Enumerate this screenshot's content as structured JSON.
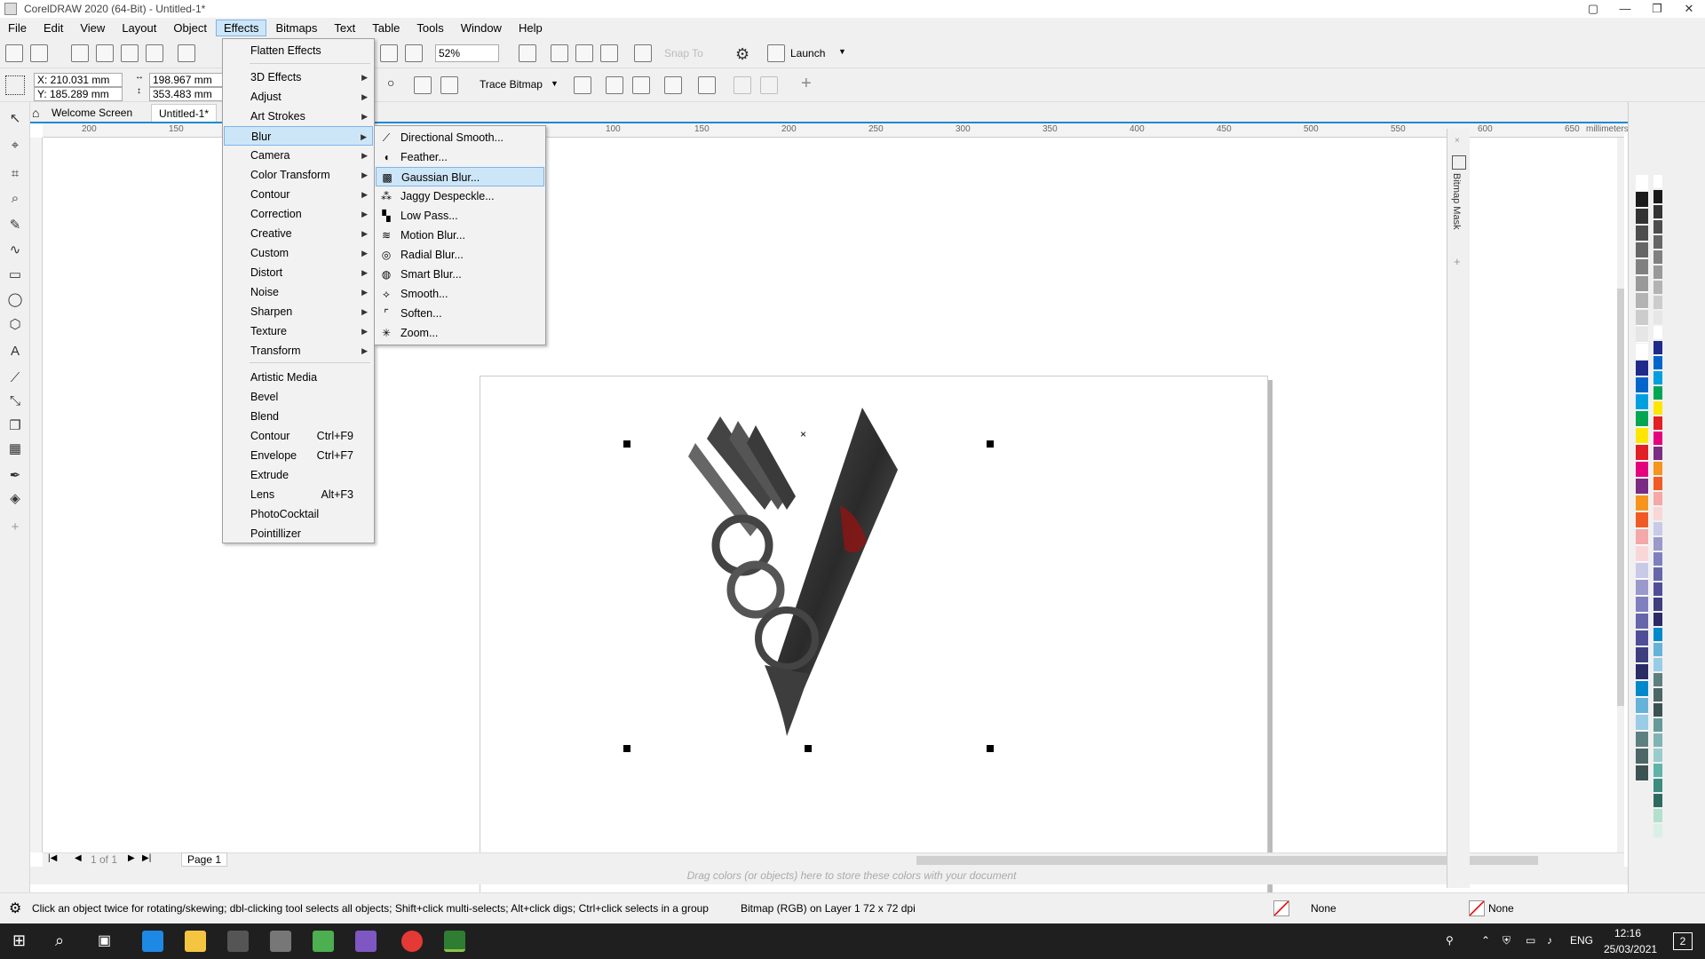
{
  "window": {
    "title": "CorelDRAW 2020 (64-Bit) - Untitled-1*"
  },
  "menubar": [
    "File",
    "Edit",
    "View",
    "Layout",
    "Object",
    "Effects",
    "Bitmaps",
    "Text",
    "Table",
    "Tools",
    "Window",
    "Help"
  ],
  "toolbar": {
    "zoom": "52%",
    "snap_to": "Snap To",
    "launch": "Launch",
    "trace_bitmap": "Trace Bitmap"
  },
  "properties": {
    "x": "X: 210.031 mm",
    "y": "Y: 185.289 mm",
    "w": "198.967 mm",
    "h": "353.483 mm"
  },
  "tabs": [
    "Welcome Screen",
    "Untitled-1*"
  ],
  "ruler": {
    "top": [
      "200",
      "150",
      "100",
      "150",
      "200",
      "250",
      "300",
      "350",
      "400",
      "450",
      "500",
      "550",
      "600",
      "650"
    ],
    "unit": "millimeters"
  },
  "effects_menu": {
    "top_item": "Flatten Effects",
    "submenus": [
      "3D Effects",
      "Adjust",
      "Art Strokes",
      "Blur",
      "Camera",
      "Color Transform",
      "Contour",
      "Correction",
      "Creative",
      "Custom",
      "Distort",
      "Noise",
      "Sharpen",
      "Texture",
      "Transform"
    ],
    "commands": [
      {
        "label": "Artistic Media",
        "shortcut": ""
      },
      {
        "label": "Bevel",
        "shortcut": ""
      },
      {
        "label": "Blend",
        "shortcut": ""
      },
      {
        "label": "Contour",
        "shortcut": "Ctrl+F9"
      },
      {
        "label": "Envelope",
        "shortcut": "Ctrl+F7"
      },
      {
        "label": "Extrude",
        "shortcut": ""
      },
      {
        "label": "Lens",
        "shortcut": "Alt+F3"
      },
      {
        "label": "PhotoCocktail",
        "shortcut": ""
      },
      {
        "label": "Pointillizer",
        "shortcut": ""
      }
    ],
    "highlighted": "Blur"
  },
  "blur_menu": {
    "items": [
      "Directional Smooth...",
      "Feather...",
      "Gaussian Blur...",
      "Jaggy Despeckle...",
      "Low Pass...",
      "Motion Blur...",
      "Radial Blur...",
      "Smart Blur...",
      "Smooth...",
      "Soften...",
      "Zoom..."
    ],
    "highlighted": "Gaussian Blur..."
  },
  "pagebar": {
    "counter": "1 of 1",
    "page": "Page 1"
  },
  "palette_hint": "Drag colors (or objects) here to store these colors with your document",
  "status": {
    "hint": "Click an object twice for rotating/skewing; dbl-clicking tool selects all objects; Shift+click multi-selects; Alt+click digs; Ctrl+click selects in a group",
    "object_info": "Bitmap (RGB) on Layer 1 72 x 72 dpi",
    "fill": "None",
    "outline": "None"
  },
  "docker": {
    "title": "Bitmap Mask"
  },
  "taskbar": {
    "lang": "ENG",
    "time": "12:16",
    "date": "25/03/2021",
    "notifications": "2"
  },
  "palette_colors": [
    "#ffffff",
    "#1a1a1a",
    "#333333",
    "#4d4d4d",
    "#666666",
    "#808080",
    "#999999",
    "#b3b3b3",
    "#cccccc",
    "#e6e6e6",
    "#ffffff",
    "#1f2a8c",
    "#0066cc",
    "#00a0e0",
    "#00a651",
    "#ffe600",
    "#e31e24",
    "#e5007e",
    "#7b2c83",
    "#f7941d",
    "#f15a24",
    "#f4a8a8",
    "#f9d7d7",
    "#c9c9e8",
    "#9999cc",
    "#7f7fbf",
    "#6666aa",
    "#4f4f99",
    "#3d3d80",
    "#2b2b66",
    "#0088cc",
    "#66b3d9",
    "#99cce6",
    "#5e7f7f",
    "#4d6666",
    "#3d5252",
    "#669999",
    "#80b3b3",
    "#99cccc",
    "#5fb3a8",
    "#3d8c80",
    "#2d6b60",
    "#b3e0cc",
    "#d9f0e6"
  ]
}
